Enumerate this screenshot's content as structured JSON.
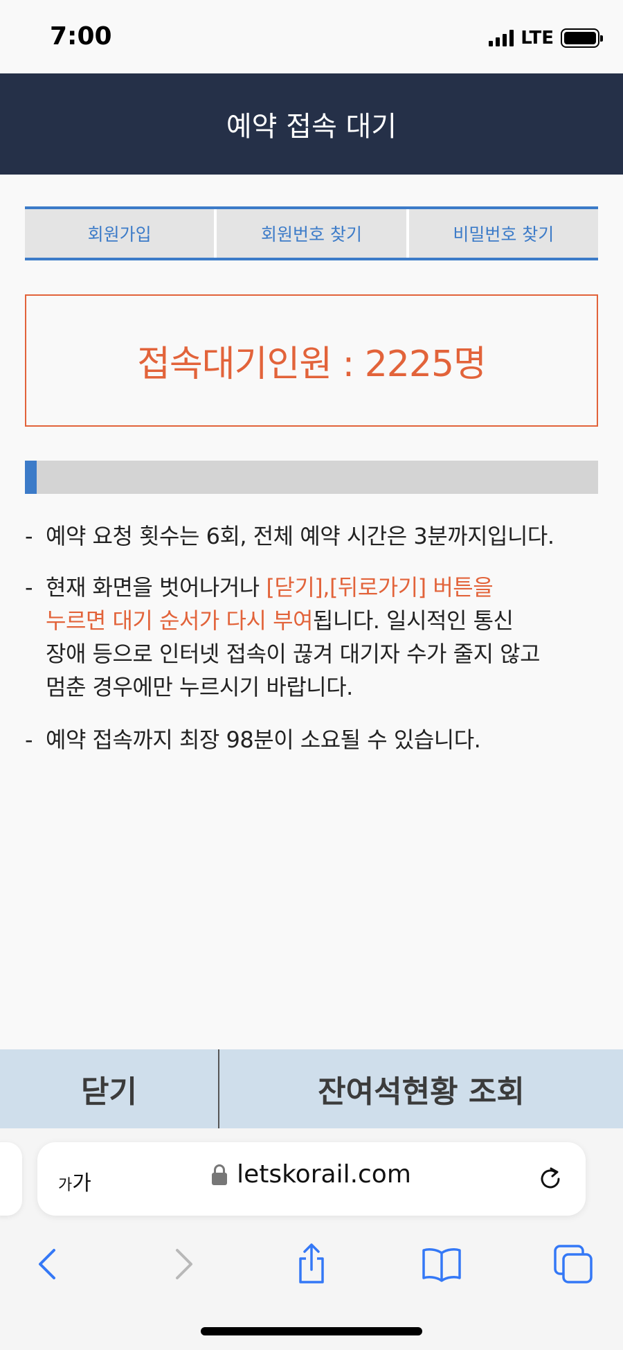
{
  "status_bar": {
    "time": "7:00",
    "network": "LTE"
  },
  "header": {
    "title": "예약 접속 대기"
  },
  "tabs": [
    {
      "label": "회원가입"
    },
    {
      "label": "회원번호 찾기"
    },
    {
      "label": "비밀번호 찾기"
    }
  ],
  "queue": {
    "text": "접속대기인원 : 2225명"
  },
  "progress": {
    "percent": 2
  },
  "notices": {
    "n1": "예약 요청 횟수는 6회, 전체 예약 시간은 3분까지입니다.",
    "n2_line1_pre": "현재 화면을 벗어나거나 ",
    "n2_line1_hl": "[닫기],[뒤로가기] 버튼을",
    "n2_line2_hl": "누르면 대기 순서가 다시 부여",
    "n2_line2_post": "됩니다. 일시적인 통신",
    "n2_line3": "장애 등으로 인터넷 접속이 끊겨 대기자 수가 줄지 않고",
    "n2_line4": "멈춘 경우에만 누르시기 바랍니다.",
    "n3": "예약 접속까지 최장 98분이 소요될 수 있습니다.",
    "dash": "-"
  },
  "buttons": {
    "close": "닫기",
    "seats": "잔여석현황 조회"
  },
  "browser": {
    "text_size_small": "가",
    "text_size_large": "가",
    "url": "letskorail.com"
  },
  "colors": {
    "header_bg": "#253048",
    "accent_blue": "#3c7bc8",
    "accent_orange": "#e2633a",
    "button_bar_bg": "#cfdeeb"
  },
  "icons": {
    "back": "chevron-left-icon",
    "forward": "chevron-right-icon",
    "share": "share-icon",
    "bookmarks": "book-icon",
    "tabs": "tabs-icon",
    "reload": "reload-icon",
    "lock": "lock-icon"
  }
}
